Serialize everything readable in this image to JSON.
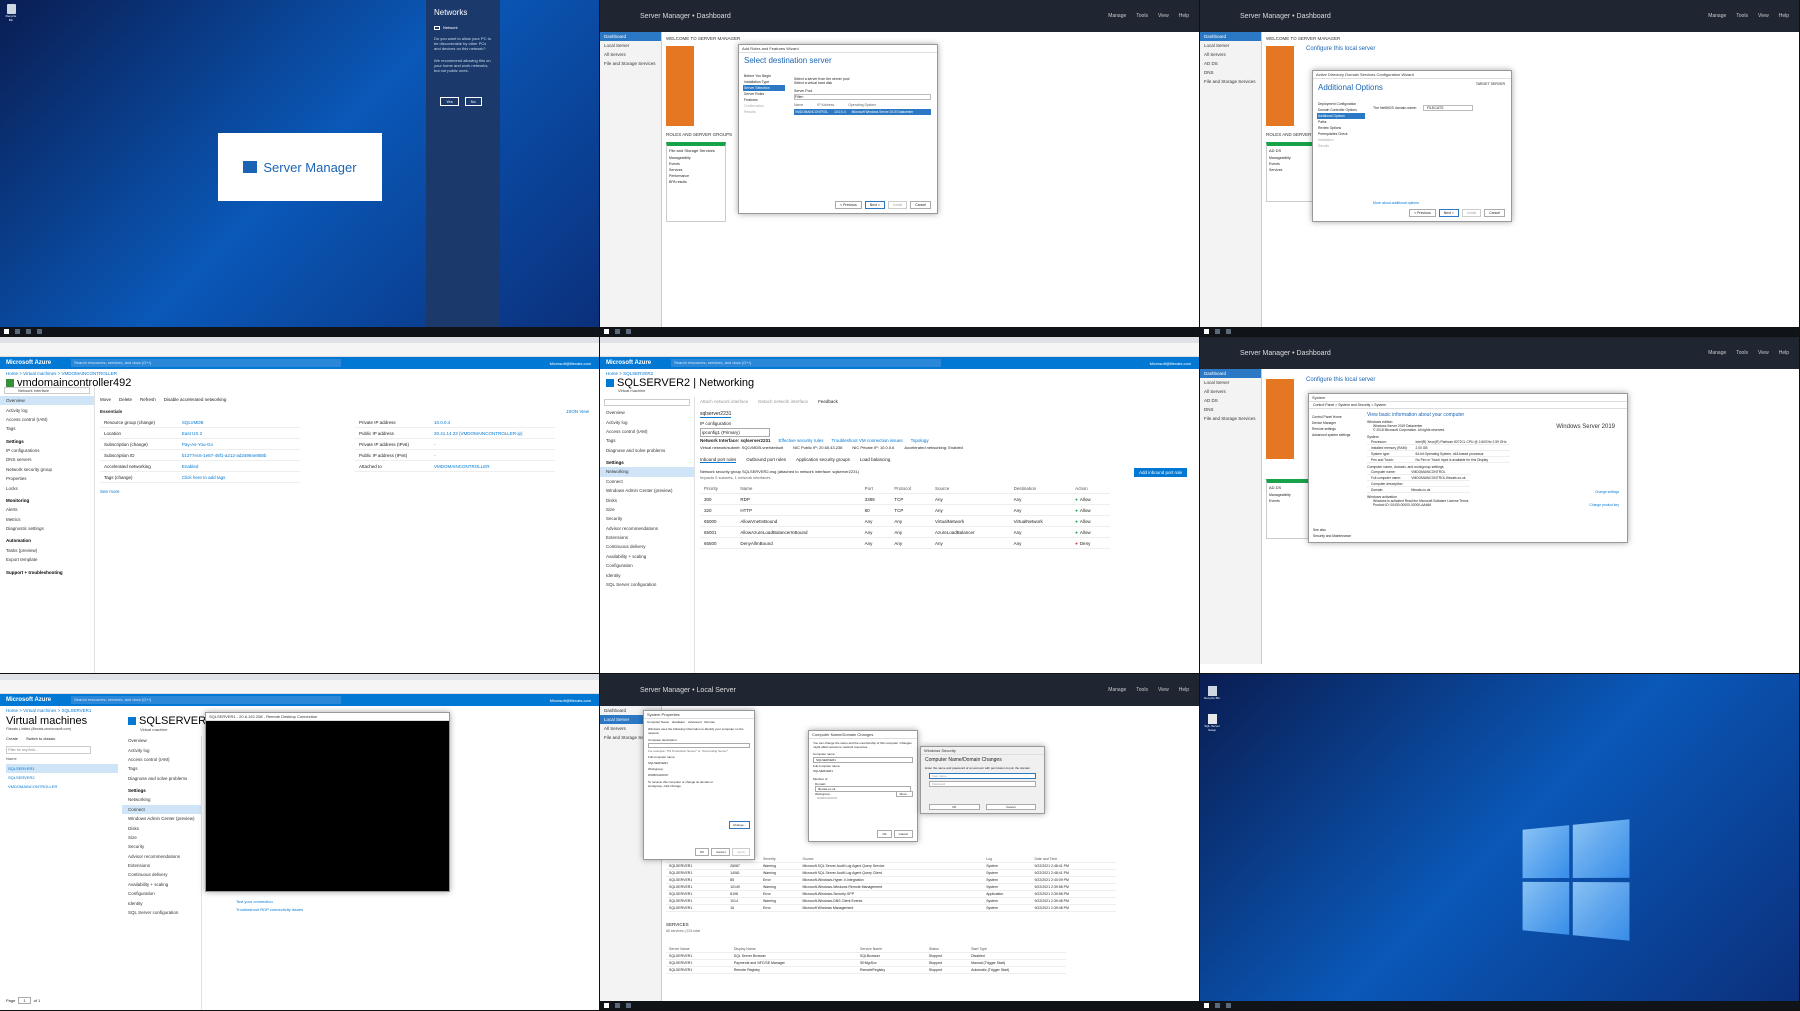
{
  "desktop": {
    "recycle_bin": "Recycle Bin"
  },
  "panel1": {
    "splash_title": "Server Manager",
    "networks": {
      "title": "Networks",
      "network_name": "Network",
      "prompt": "Do you want to allow your PC to be discoverable by other PCs and devices on this network?",
      "recommendation": "We recommend allowing this on your home and work networks, but not public ones.",
      "yes": "Yes",
      "no": "No"
    }
  },
  "server_manager": {
    "title": "Server Manager",
    "dashboard": "Dashboard",
    "local_server": "Local Server",
    "crumb_dashboard": "Server Manager • Dashboard",
    "crumb_local": "Server Manager • Local Server",
    "menu": [
      "Manage",
      "Tools",
      "View",
      "Help"
    ],
    "nav": [
      "Dashboard",
      "Local Server",
      "All Servers",
      "File and Storage Services"
    ],
    "nav_ad": [
      "Dashboard",
      "Local Server",
      "All Servers",
      "AD DS",
      "DNS",
      "File and Storage Services"
    ],
    "welcome": "WELCOME TO SERVER MANAGER",
    "configure": "Configure this local server",
    "add_roles": "Add roles and features",
    "roles_groups": "ROLES AND SERVER GROUPS",
    "tile_items": [
      "Manageability",
      "Events",
      "Services",
      "Performance",
      "BPA results"
    ],
    "file_storage": "File and Storage Services",
    "ad_ds": "AD DS"
  },
  "panel2": {
    "wizard_title": "Add Roles and Features Wizard",
    "heading": "Select destination server",
    "steps": [
      "Before You Begin",
      "Installation Type",
      "Server Selection",
      "Server Roles",
      "Features",
      "Confirmation",
      "Results"
    ],
    "option1": "Select a server from the server pool",
    "option2": "Select a virtual hard disk",
    "server_pool": "Server Pool",
    "filter": "Filter:",
    "columns": [
      "Name",
      "IP Address",
      "Operating System"
    ],
    "row": [
      "VMDOMAINCONTROL",
      "10.0.0.4",
      "Microsoft Windows Server 2019 Datacenter"
    ],
    "buttons": [
      "< Previous",
      "Next >",
      "Install",
      "Cancel"
    ]
  },
  "panel3": {
    "wizard_title": "Active Directory Domain Services Configuration Wizard",
    "heading": "Additional Options",
    "target": "TARGET SERVER",
    "steps": [
      "Deployment Configuration",
      "Domain Controller Options",
      "Additional Options",
      "Paths",
      "Review Options",
      "Prerequisites Check",
      "Installation",
      "Results"
    ],
    "netbios_label": "The NetBIOS domain name:",
    "netbios_value": "FILECATS",
    "more": "More about additional options",
    "buttons": [
      "< Previous",
      "Next >",
      "Install",
      "Cancel"
    ]
  },
  "azure1": {
    "brand": "Microsoft Azure",
    "search": "Search resources, services, and docs (G+/)",
    "user": "Microsoft@filecats.com",
    "crumbs": [
      "Home",
      "Virtual machines",
      "VMDOMAINCONTROLLER"
    ],
    "title": "vmdomaincontroller492",
    "subtitle": "Network interface",
    "actions": [
      "Move",
      "Delete",
      "Refresh",
      "Disable accelerated networking"
    ],
    "side": [
      "Overview",
      "Activity log",
      "Access control (IAM)",
      "Tags"
    ],
    "settings_group": "Settings",
    "settings": [
      "IP configurations",
      "DNS servers",
      "Network security group",
      "Properties",
      "Locks"
    ],
    "monitoring_group": "Monitoring",
    "monitoring": [
      "Alerts",
      "Metrics",
      "Diagnostic settings"
    ],
    "automation_group": "Automation",
    "automation": [
      "Tasks (preview)",
      "Export template"
    ],
    "support_group": "Support + troubleshooting",
    "essentials": "Essentials",
    "json_view": "JSON View",
    "left_fields": [
      [
        "Resource group (change)",
        "SQLVMDB"
      ],
      [
        "Location",
        "East US 2"
      ],
      [
        "Subscription (change)",
        "Pay-As-You-Go"
      ],
      [
        "Subscription ID",
        "b1377ec6-1e87-48f1-a212-ad34994e858b"
      ],
      [
        "Accelerated networking",
        "Enabled"
      ],
      [
        "Tags (change)",
        "Click here to add tags"
      ]
    ],
    "right_fields": [
      [
        "Private IP address",
        "10.0.0.4"
      ],
      [
        "Public IP address",
        "20.41.14.23 (VMDOMAINCONTROLLER-ip)"
      ],
      [
        "Private IP address (IPv6)",
        "-"
      ],
      [
        "Public IP address (IPv6)",
        "-"
      ],
      [
        "Attached to",
        "VMDOMAINCONTROLLER"
      ]
    ],
    "see_more": "See more"
  },
  "azure2": {
    "brand": "Microsoft Azure",
    "search": "Search resources, services, and docs (G+/)",
    "user": "Microsoft@filecats.com",
    "crumbs": [
      "Home",
      "SQLSERVER2"
    ],
    "title": "SQLSERVER2 | Networking",
    "subtitle": "Virtual machine",
    "actions": [
      "Attach network interface",
      "Detach network interface",
      "Feedback"
    ],
    "side": [
      "Overview",
      "Activity log",
      "Access control (IAM)",
      "Tags",
      "Diagnose and solve problems"
    ],
    "settings_group": "Settings",
    "settings": [
      "Networking",
      "Connect",
      "Windows Admin Center (preview)",
      "Disks",
      "Size",
      "Security",
      "Advisor recommendations",
      "Extensions",
      "Continuous delivery",
      "Availability + scaling",
      "Configuration",
      "Identity",
      "SQL Server configuration"
    ],
    "nic_name": "sqlserver2231",
    "ip_config_label": "IP configuration",
    "ip_config_value": "ipconfig1 (Primary)",
    "nic_line": "Network Interface: sqlserver2231",
    "nic_links": [
      "Effective security rules",
      "Troubleshoot VM connection issues",
      "Topology"
    ],
    "vnet": "Virtual network/subnet: SQLVMDB-vnet/default",
    "nic_public_ip": "NIC Public IP: 20.65.43.236",
    "nic_private_ip": "NIC Private IP: 10.0.0.6",
    "accel": "Accelerated networking: Enabled",
    "tabs": [
      "Inbound port rules",
      "Outbound port rules",
      "Application security groups",
      "Load balancing"
    ],
    "nsg_line": "Network security group SQLSERVER2-nsg (attached to network interface: sqlserver2231)",
    "nsg_sub": "Impacts 0 subnets, 1 network interfaces",
    "add_rule": "Add inbound port rule",
    "columns": [
      "Priority",
      "Name",
      "Port",
      "Protocol",
      "Source",
      "Destination",
      "Action"
    ],
    "rules": [
      [
        "300",
        "RDP",
        "3389",
        "TCP",
        "Any",
        "Any",
        "Allow"
      ],
      [
        "320",
        "HTTP",
        "80",
        "TCP",
        "Any",
        "Any",
        "Allow"
      ],
      [
        "65000",
        "AllowVnetInBound",
        "Any",
        "Any",
        "VirtualNetwork",
        "VirtualNetwork",
        "Allow"
      ],
      [
        "65001",
        "AllowAzureLoadBalancerInBound",
        "Any",
        "Any",
        "AzureLoadBalancer",
        "Any",
        "Allow"
      ],
      [
        "65500",
        "DenyAllInBound",
        "Any",
        "Any",
        "Any",
        "Any",
        "Deny"
      ]
    ]
  },
  "panel6": {
    "system_title": "System",
    "path": "Control Panel > System and Security > System",
    "links": [
      "Control Panel Home",
      "Device Manager",
      "Remote settings",
      "Advanced system settings"
    ],
    "heading": "View basic information about your computer",
    "edition_group": "Windows edition",
    "edition": "Windows Server 2019 Datacenter",
    "copyright": "© 2018 Microsoft Corporation. All rights reserved.",
    "brand": "Windows Server 2019",
    "system_group": "System",
    "sys_fields": [
      [
        "Processor:",
        "Intel(R) Xeon(R) Platinum 8272CL CPU @ 2.60GHz 2.59 GHz"
      ],
      [
        "Installed memory (RAM):",
        "2.00 GB"
      ],
      [
        "System type:",
        "64-bit Operating System, x64-based processor"
      ],
      [
        "Pen and Touch:",
        "No Pen or Touch Input is available for this Display"
      ]
    ],
    "name_group": "Computer name, domain, and workgroup settings",
    "name_fields": [
      [
        "Computer name:",
        "VMDOMAINCONTROL"
      ],
      [
        "Full computer name:",
        "VMDOMAINCONTROL.filecats.co.uk"
      ],
      [
        "Computer description:",
        ""
      ],
      [
        "Domain:",
        "filecats.co.uk"
      ]
    ],
    "change_settings": "Change settings",
    "activation_group": "Windows activation",
    "activation": "Windows is activated  Read the Microsoft Software License Terms",
    "product_id": "Product ID: 00430-00000-00000-AA466",
    "change_key": "Change product key",
    "see_also": "See also",
    "security": "Security and Maintenance"
  },
  "panel7": {
    "brand": "Microsoft Azure",
    "search": "Search resources, services, and docs (G+/)",
    "user": "Microsoft@filecats.com",
    "crumbs": [
      "Home",
      "Virtual machines",
      "SQLSERVER1"
    ],
    "vm_list_title": "Virtual machines",
    "vm_list_sub": "Filecats Limited (filecats.onmicrosoft.com)",
    "vm_actions": [
      "Create",
      "Switch to classic"
    ],
    "filter": "Filter for any field...",
    "name_col": "Name",
    "vms": [
      "SQLSERVER1",
      "SQLSERVER2",
      "VMDOMAINCONTROLLER"
    ],
    "title": "SQLSERVER1",
    "subtitle": "Virtual machine",
    "side": [
      "Overview",
      "Activity log",
      "Access control (IAM)",
      "Tags",
      "Diagnose and solve problems"
    ],
    "settings_group": "Settings",
    "settings": [
      "Networking",
      "Connect",
      "Windows Admin Center (preview)",
      "Disks",
      "Size",
      "Security",
      "Advisor recommendations",
      "Extensions",
      "Continuous delivery",
      "Availability + scaling",
      "Configuration",
      "Identity",
      "SQL Server configuration"
    ],
    "rdp_title": "SQLSERVER1 - 20.6.192.208 - Remote Desktop Connection",
    "test": "Test your connection",
    "troubleshoot": "Troubleshoot RDP connectivity issues",
    "page": "Page",
    "page_num": "1",
    "of": "of 1"
  },
  "panel8": {
    "props": "PROPERTIES",
    "props_for": "For SQLSERVER1",
    "sys_props_title": "System Properties",
    "sys_tabs": [
      "Computer Name",
      "Hardware",
      "Advanced",
      "Remote"
    ],
    "sys_desc": "Windows uses the following information to identify your computer on the network.",
    "comp_desc_label": "Computer description:",
    "comp_desc_hint": "For example: \"IIS Production Server\" or \"Accounting Server\".",
    "full_name_label": "Full computer name:",
    "full_name": "SQLSERVER1",
    "workgroup_label": "Workgroup:",
    "workgroup": "WORKGROUP",
    "rename_text": "To rename this computer or change its domain or workgroup, click Change.",
    "change": "Change...",
    "ok": "OK",
    "cancel": "Cancel",
    "apply": "Apply",
    "cnd_title": "Computer Name/Domain Changes",
    "cnd_desc": "You can change the name and the membership of this computer. Changes might affect access to network resources.",
    "cnd_name_label": "Computer name:",
    "cnd_name": "SQLSERVER1",
    "cnd_full_label": "Full computer name:",
    "cnd_full": "SQLSERVER1",
    "more": "More...",
    "member_of": "Member of",
    "domain_radio": "Domain:",
    "domain_value": "filecats.co.uk",
    "workgroup_radio": "Workgroup:",
    "workgroup_value": "WORKGROUP",
    "sec_title": "Windows Security",
    "sec_heading": "Computer Name/Domain Changes",
    "sec_text": "Enter the name and password of an account with permission to join the domain.",
    "user_ph": "User name",
    "pass_ph": "Password",
    "events_cols": [
      "Server Name",
      "ID",
      "Severity",
      "Source",
      "Log",
      "Date and Time"
    ],
    "events": [
      [
        "SQLSERVER1",
        "26067",
        "Warning",
        "Microsoft SQL Server Audit Log Agent Query Service",
        "System",
        "9/22/2021 2:48:41 PM"
      ],
      [
        "SQLSERVER1",
        "14061",
        "Warning",
        "Microsoft SQL Server Audit Log Agent Query Client",
        "System",
        "9/22/2021 2:48:41 PM"
      ],
      [
        "SQLSERVER1",
        "85",
        "Error",
        "Microsoft-Windows-Hyper-V-Integration",
        "System",
        "9/22/2021 2:40:09 PM"
      ],
      [
        "SQLSERVER1",
        "10149",
        "Warning",
        "Microsoft-Windows-Windows Remote Management",
        "System",
        "9/22/2021 2:39:58 PM"
      ],
      [
        "SQLSERVER1",
        "8198",
        "Error",
        "Microsoft-Windows-Security-SPP",
        "Application",
        "9/22/2021 2:39:58 PM"
      ],
      [
        "SQLSERVER1",
        "1014",
        "Warning",
        "Microsoft-Windows-DNS Client Events",
        "System",
        "9/22/2021 2:39:48 PM"
      ],
      [
        "SQLSERVER1",
        "16",
        "Error",
        "Microsoft Windows Management",
        "System",
        "9/22/2021 2:39:48 PM"
      ]
    ],
    "services": "SERVICES",
    "services_sub": "All services | 224 total",
    "svc_cols": [
      "Server Name",
      "Display Name",
      "Service Name",
      "Status",
      "Start Type"
    ],
    "svcs": [
      [
        "SQLSERVER1",
        "SQL Server Browser",
        "SQLBrowser",
        "Stopped",
        "Disabled"
      ],
      [
        "SQLSERVER1",
        "Payments and NFC/SE Manager",
        "SEMgrSvc",
        "Stopped",
        "Manual (Trigger Start)"
      ],
      [
        "SQLSERVER1",
        "Remote Registry",
        "RemoteRegistry",
        "Stopped",
        "Automatic (Trigger Start)"
      ]
    ]
  },
  "panel9": {
    "recycle_bin": "Recycle Bin",
    "sql_setup": "SQL Server Setup"
  }
}
